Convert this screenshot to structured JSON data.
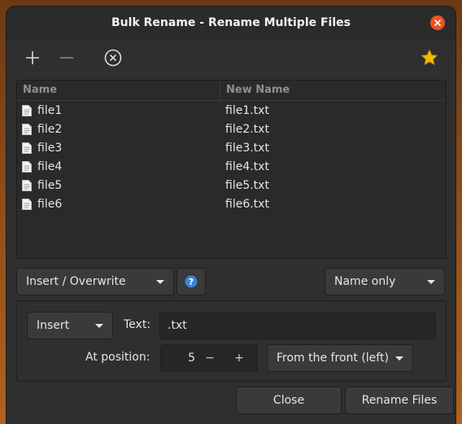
{
  "window": {
    "title": "Bulk Rename - Rename Multiple Files"
  },
  "toolbar": {
    "add_icon": "plus-icon",
    "remove_icon": "minus-icon",
    "clear_icon": "circle-x-icon",
    "favorite_icon": "star-icon"
  },
  "list": {
    "columns": [
      "Name",
      "New Name"
    ],
    "rows": [
      {
        "name": "file1",
        "new_name": "file1.txt"
      },
      {
        "name": "file2",
        "new_name": "file2.txt"
      },
      {
        "name": "file3",
        "new_name": "file3.txt"
      },
      {
        "name": "file4",
        "new_name": "file4.txt"
      },
      {
        "name": "file5",
        "new_name": "file5.txt"
      },
      {
        "name": "file6",
        "new_name": "file6.txt"
      }
    ]
  },
  "mode": {
    "selected": "Insert / Overwrite",
    "help_icon": "help-icon",
    "scope": "Name only"
  },
  "options": {
    "action": "Insert",
    "text_label": "Text:",
    "text_value": ".txt",
    "position_label": "At position:",
    "position_value": "5",
    "decrement": "−",
    "increment": "+",
    "direction": "From the front (left)"
  },
  "buttons": {
    "close": "Close",
    "rename": "Rename Files"
  },
  "colors": {
    "accent": "#e95420",
    "help_blue": "#3b82d6",
    "star": "#f5b800"
  }
}
